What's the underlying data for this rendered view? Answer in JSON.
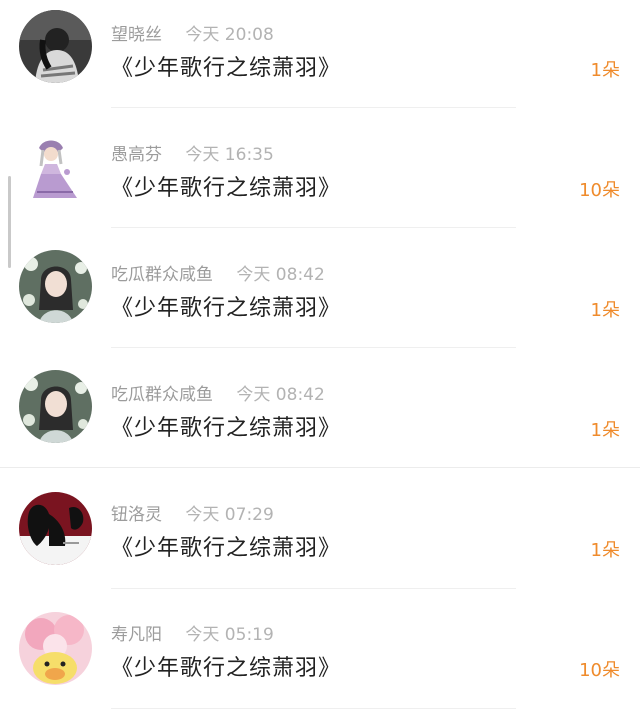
{
  "items": [
    {
      "name": "望晓丝",
      "time": "今天 20:08",
      "title": "《少年歌行之综萧羽》",
      "count": "1朵"
    },
    {
      "name": "愚高芬",
      "time": "今天 16:35",
      "title": "《少年歌行之综萧羽》",
      "count": "10朵"
    },
    {
      "name": "吃瓜群众咸鱼",
      "time": "今天 08:42",
      "title": "《少年歌行之综萧羽》",
      "count": "1朵"
    },
    {
      "name": "吃瓜群众咸鱼",
      "time": "今天 08:42",
      "title": "《少年歌行之综萧羽》",
      "count": "1朵"
    },
    {
      "name": "钮洛灵",
      "time": "今天 07:29",
      "title": "《少年歌行之综萧羽》",
      "count": "1朵"
    },
    {
      "name": "寿凡阳",
      "time": "今天 05:19",
      "title": "《少年歌行之综萧羽》",
      "count": "10朵"
    }
  ],
  "colors": {
    "count": "#ef8b2c",
    "name": "#9c9c9c",
    "time": "#b3b3b3",
    "title": "#222222"
  }
}
